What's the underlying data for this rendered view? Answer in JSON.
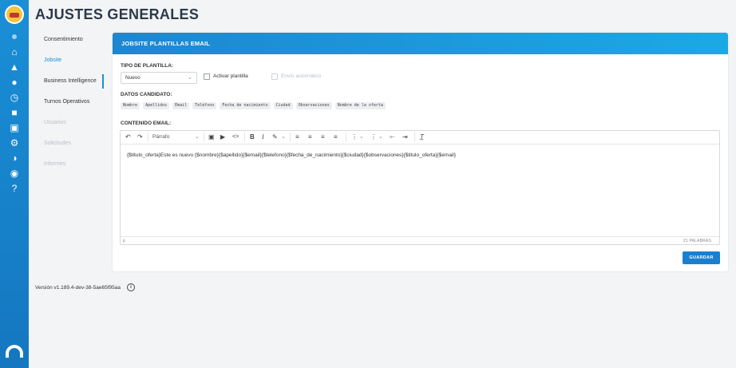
{
  "page": {
    "title": "AJUSTES GENERALES"
  },
  "subnav": {
    "items": [
      {
        "label": "Consentimiento",
        "state": "normal"
      },
      {
        "label": "Jobsite",
        "state": "active"
      },
      {
        "label": "Business Intelligence",
        "state": "normal"
      },
      {
        "label": "Turnos Operativos",
        "state": "normal"
      },
      {
        "label": "Usuarios",
        "state": "disabled"
      },
      {
        "label": "Solicitudes",
        "state": "disabled"
      },
      {
        "label": "Informes",
        "state": "disabled"
      }
    ]
  },
  "card": {
    "header": "JOBSITE PLANTILLAS EMAIL",
    "template_type_label": "TIPO DE PLANTILLA:",
    "template_select_value": "Nuevo",
    "activate_label": "Activar plantilla",
    "auto_send_label": "Envío automático",
    "candidate_data_label": "DATOS CANDIDATO:",
    "chips": [
      "Nombre",
      "Apellidos",
      "Email",
      "Teléfono",
      "Fecha de nacimiento",
      "Ciudad",
      "Observaciones",
      "Nombre de la oferta"
    ],
    "email_content_label": "CONTENIDO EMAIL:",
    "format_select": "Párrafo",
    "editor_text": "{$titulo_oferta}Este es nuevo {$nombre}{$apellido}{$email}{$telefono}{$fecha_de_nacimiento}{$ciudad}{$observaciones}{$titulo_oferta}{$email}",
    "status_path": "p",
    "word_count": "21 PALABRAS",
    "save_label": "GUARDAR"
  },
  "footer": {
    "version": "Versión v1.189.4-dev-38-5ae65f95aa"
  },
  "colors": {
    "accent": "#1a8fd6",
    "header_gradient_start": "#1f86cf",
    "header_gradient_end": "#1ba9e4",
    "button": "#1a7fcf"
  },
  "icons": {
    "rail": [
      "app-logo-icon",
      "home-icon",
      "bell-icon",
      "users-icon",
      "clock-icon",
      "briefcase-icon",
      "id-card-icon",
      "gear-icon",
      "pie-chart-icon",
      "chat-icon",
      "help-icon",
      "brand-icon"
    ],
    "toolbar": [
      "undo-icon",
      "redo-icon",
      "image-icon",
      "media-icon",
      "code-icon",
      "bold-icon",
      "italic-icon",
      "highlight-icon",
      "align-left-icon",
      "align-center-icon",
      "align-right-icon",
      "align-justify-icon",
      "bullet-list-icon",
      "numbered-list-icon",
      "outdent-icon",
      "indent-icon",
      "clear-format-icon"
    ]
  }
}
